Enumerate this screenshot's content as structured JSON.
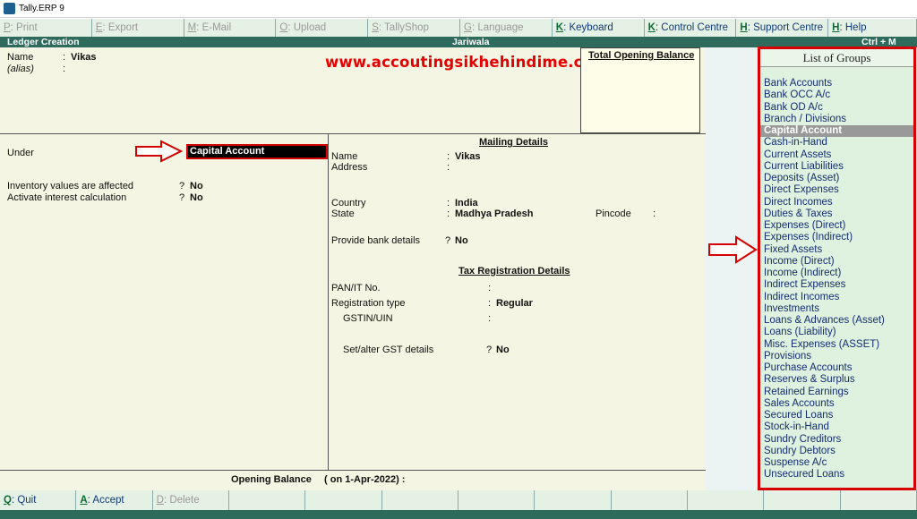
{
  "window": {
    "title": "Tally.ERP 9"
  },
  "topbar": [
    {
      "key": "P",
      "label": ": Print",
      "active": false,
      "w": 103
    },
    {
      "key": "E",
      "label": ": Export",
      "active": false,
      "w": 103
    },
    {
      "key": "M",
      "label": ": E-Mail",
      "active": false,
      "w": 103
    },
    {
      "key": "O",
      "label": ": Upload",
      "active": false,
      "w": 103
    },
    {
      "key": "S",
      "label": ": TallyShop",
      "active": false,
      "w": 103
    },
    {
      "key": "G",
      "label": ": Language",
      "active": false,
      "w": 103
    },
    {
      "key": "K",
      "label": ": Keyboard",
      "active": true,
      "w": 103
    },
    {
      "key": "K",
      "label": ": Control Centre",
      "active": true,
      "w": 103
    },
    {
      "key": "H",
      "label": ": Support Centre",
      "active": true,
      "w": 103
    },
    {
      "key": "H",
      "label": ": Help",
      "active": true,
      "w": 99
    }
  ],
  "header": {
    "left": "Ledger Creation",
    "center": "Jariwala",
    "right": "Ctrl + M"
  },
  "website": "www.accoutingsikhehindime.com",
  "ledger": {
    "name_label": "Name",
    "name_value": "Vikas",
    "alias_label": "(alias)",
    "total_opening_balance_label": "Total Opening Balance",
    "under_label": "Under",
    "under_value": "Capital Account",
    "inventory_label": "Inventory values are affected",
    "inventory_value": "No",
    "interest_label": "Activate interest calculation",
    "interest_value": "No",
    "opening_balance_label": "Opening Balance",
    "opening_balance_date": "( on 1-Apr-2022) :"
  },
  "mailing": {
    "heading": "Mailing Details",
    "name_label": "Name",
    "name_value": "Vikas",
    "address_label": "Address",
    "country_label": "Country",
    "country_value": "India",
    "state_label": "State",
    "state_value": "Madhya Pradesh",
    "pincode_label": "Pincode",
    "bank_label": "Provide bank details",
    "bank_value": "No"
  },
  "tax": {
    "heading": "Tax Registration Details",
    "pan_label": "PAN/IT No.",
    "regtype_label": "Registration type",
    "regtype_value": "Regular",
    "gstin_label": "GSTIN/UIN",
    "gst_label": "Set/alter GST details",
    "gst_value": "No"
  },
  "groups": {
    "title": "List of Groups",
    "selected": "Capital Account",
    "items": [
      "Bank Accounts",
      "Bank OCC A/c",
      "Bank OD A/c",
      "Branch / Divisions",
      "Capital Account",
      "Cash-in-Hand",
      "Current Assets",
      "Current Liabilities",
      "Deposits (Asset)",
      "Direct Expenses",
      "Direct Incomes",
      "Duties & Taxes",
      "Expenses (Direct)",
      "Expenses (Indirect)",
      "Fixed Assets",
      "Income (Direct)",
      "Income (Indirect)",
      "Indirect Expenses",
      "Indirect Incomes",
      "Investments",
      "Loans & Advances (Asset)",
      "Loans (Liability)",
      "Misc. Expenses (ASSET)",
      "Provisions",
      "Purchase Accounts",
      "Reserves & Surplus",
      "Retained Earnings",
      "Sales Accounts",
      "Secured Loans",
      "Stock-in-Hand",
      "Sundry Creditors",
      "Sundry Debtors",
      "Suspense A/c",
      "Unsecured Loans"
    ]
  },
  "bottombar": [
    {
      "key": "Q",
      "label": ": Quit",
      "active": true
    },
    {
      "key": "A",
      "label": ": Accept",
      "active": true
    },
    {
      "key": "D",
      "label": ": Delete",
      "active": false
    },
    {
      "key": "",
      "label": "",
      "active": false
    },
    {
      "key": "",
      "label": "",
      "active": false
    },
    {
      "key": "",
      "label": "",
      "active": false
    },
    {
      "key": "",
      "label": "",
      "active": false
    },
    {
      "key": "",
      "label": "",
      "active": false
    },
    {
      "key": "",
      "label": "",
      "active": false
    },
    {
      "key": "",
      "label": "",
      "active": false
    },
    {
      "key": "",
      "label": "",
      "active": false
    },
    {
      "key": "",
      "label": "",
      "active": false
    }
  ],
  "colors": {
    "accent": "#2f6b5d",
    "highlight_red": "#d60000",
    "link_blue": "#142c72"
  }
}
